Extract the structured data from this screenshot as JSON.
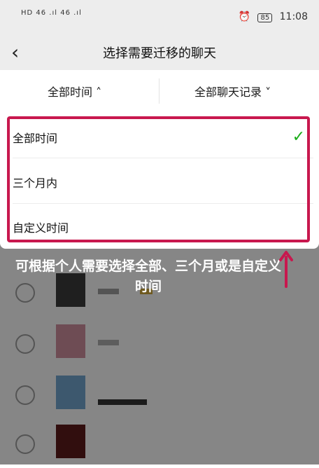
{
  "status_bar": {
    "left": "HD 46 .ıl 46 .ıl",
    "battery": "85",
    "time": "11:08"
  },
  "nav": {
    "back_glyph": "‹",
    "title": "选择需要迁移的聊天"
  },
  "filters": {
    "time": "全部时间 ˄",
    "records": "全部聊天记录 ˅"
  },
  "dropdown": {
    "options": [
      "全部时间",
      "三个月内",
      "自定义时间"
    ],
    "selected_index": 0,
    "check": "✓"
  },
  "caption": "可根据个人需要选择全部、三个月或是自定义时间",
  "colors": {
    "highlight": "#c8184e",
    "check": "#1aad19",
    "header_bg": "#ededed"
  }
}
